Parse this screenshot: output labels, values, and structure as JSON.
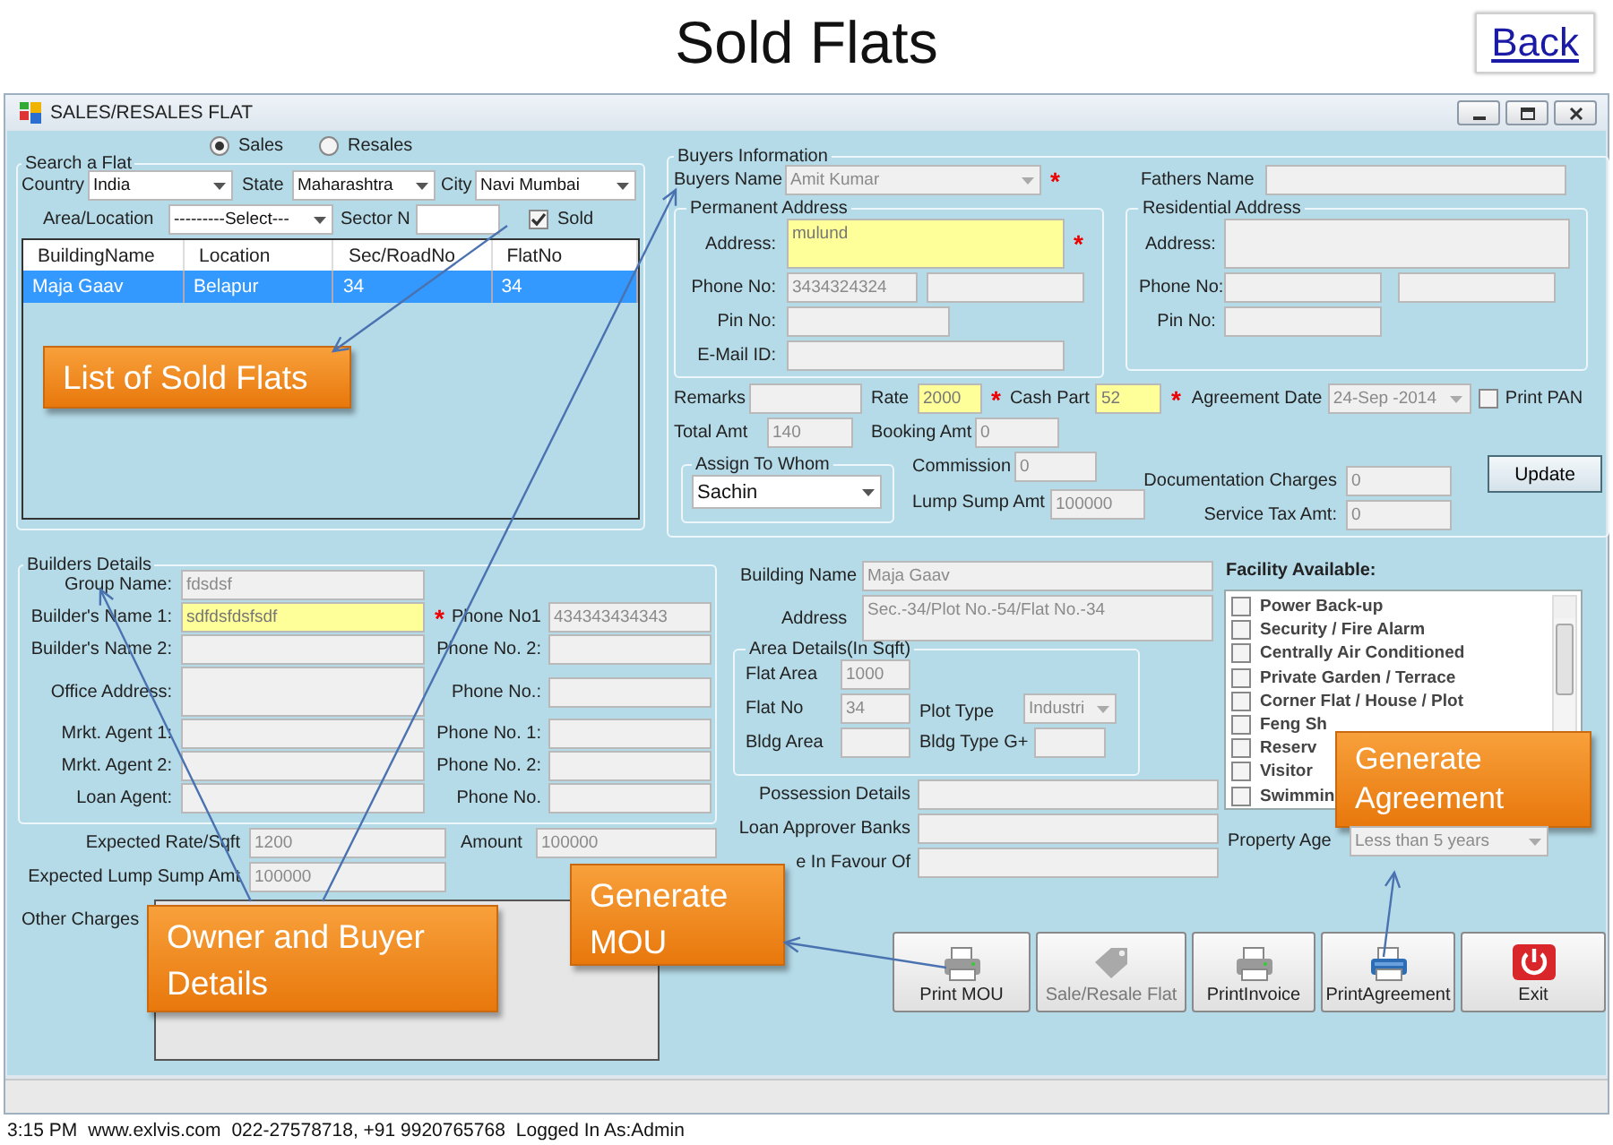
{
  "header": {
    "title": "Sold Flats",
    "back_link": "Back"
  },
  "window": {
    "title": "SALES/RESALES FLAT"
  },
  "sale_type": [
    {
      "label": "Sales",
      "selected": true
    },
    {
      "label": "Resales",
      "selected": false
    }
  ],
  "search_group": {
    "title": "Search a Flat",
    "country": {
      "label": "Country",
      "value": "India",
      "kind": "dropdown",
      "disabled": false
    },
    "state": {
      "label": "State",
      "value": "Maharashtra",
      "kind": "dropdown",
      "disabled": false
    },
    "city": {
      "label": "City",
      "value": "Navi Mumbai",
      "kind": "dropdown",
      "disabled": false
    },
    "area": {
      "label": "Area/Location",
      "value": "---------Select---",
      "kind": "dropdown",
      "disabled": false
    },
    "sector": {
      "label": "Sector N",
      "kind": "text",
      "disabled": false
    },
    "sold": {
      "label": "Sold",
      "checked": true
    },
    "table": {
      "columns": [
        "BuildingName",
        "Location",
        "Sec/RoadNo",
        "FlatNo"
      ],
      "rows": [
        {
          "cells": [
            "Maja Gaav",
            "Belapur",
            "34",
            "34"
          ],
          "selected": true
        }
      ]
    }
  },
  "buyers_group": {
    "title": "Buyers Information",
    "buyers_name": {
      "label": "Buyers Name",
      "value": "Amit Kumar",
      "kind": "dropdown",
      "disabled": true,
      "mark": "*"
    },
    "fathers_name": {
      "label": "Fathers Name",
      "kind": "text",
      "disabled": true
    },
    "permanent_address": {
      "title": "Permanent Address",
      "address": {
        "label": "Address:",
        "value": "mulund",
        "kind": "text",
        "disabled": false,
        "required": true,
        "mark": "*"
      },
      "phone": {
        "label": "Phone No:",
        "value": "3434324324",
        "kind": "text",
        "disabled": true
      },
      "phone_2": {
        "kind": "text",
        "disabled": true
      },
      "pin": {
        "label": "Pin No:",
        "kind": "text",
        "disabled": true
      },
      "email": {
        "label": "E-Mail ID:",
        "kind": "text",
        "disabled": true
      }
    },
    "residential_address": {
      "title": "Residential Address",
      "address": {
        "label": "Address:",
        "kind": "text",
        "disabled": true
      },
      "phone": {
        "label": "Phone No:",
        "kind": "text",
        "disabled": true
      },
      "phone_2": {
        "kind": "text",
        "disabled": true
      },
      "pin": {
        "label": "Pin No:",
        "kind": "text",
        "disabled": true
      }
    },
    "remarks": {
      "label": "Remarks",
      "kind": "text",
      "disabled": true
    },
    "rate": {
      "label": "Rate",
      "value": "2000",
      "kind": "text",
      "disabled": false,
      "required": true,
      "mark": "*"
    },
    "cash_part": {
      "label": "Cash Part",
      "value": "52",
      "kind": "text",
      "disabled": false,
      "required": true,
      "mark": "*"
    },
    "agreement_date": {
      "label": "Agreement Date",
      "value": "24-Sep -2014",
      "kind": "dropdown",
      "disabled": true
    },
    "print_pan": {
      "label": "Print PAN",
      "checked": false
    },
    "total_amt": {
      "label": "Total Amt",
      "value": "140",
      "kind": "text",
      "disabled": true
    },
    "booking_amt": {
      "label": "Booking Amt",
      "value": "0",
      "kind": "text",
      "disabled": true
    },
    "assign_group": {
      "title": "Assign  To Whom",
      "assignee": {
        "value": "Sachin",
        "kind": "dropdown",
        "disabled": false
      }
    },
    "commission": {
      "label": "Commission",
      "value": "0",
      "kind": "text",
      "disabled": true
    },
    "lump_sump_amt": {
      "label": "Lump Sump Amt",
      "value": "100000",
      "kind": "text",
      "disabled": true
    },
    "documentation_charges": {
      "label": "Documentation Charges",
      "value": "0",
      "kind": "text",
      "disabled": true
    },
    "service_tax_amt": {
      "label": "Service Tax Amt:",
      "value": "0",
      "kind": "text",
      "disabled": true
    },
    "update_button": "Update"
  },
  "builders_group": {
    "title": "Builders Details",
    "group_name": {
      "label": "Group Name:",
      "value": "fdsdsf",
      "kind": "text",
      "disabled": true
    },
    "builder_name_1": {
      "label": "Builder's Name 1:",
      "value": "sdfdsfdsfsdf",
      "kind": "text",
      "disabled": false,
      "required": true
    },
    "phone_no1": {
      "label": "Phone No1",
      "value": "434343434343",
      "kind": "text",
      "disabled": true,
      "mark": "*"
    },
    "builder_name_2": {
      "label": "Builder's Name 2:",
      "kind": "text",
      "disabled": true
    },
    "phone_no_2": {
      "label": "Phone No. 2:",
      "kind": "text",
      "disabled": true
    },
    "office_address": {
      "label": "Office Address:",
      "kind": "text",
      "disabled": true
    },
    "office_phone": {
      "label": "Phone No.:",
      "kind": "text",
      "disabled": true
    },
    "agent_1": {
      "label": "Mrkt. Agent 1:",
      "kind": "text",
      "disabled": true
    },
    "agent_1_phone": {
      "label": "Phone No. 1:",
      "kind": "text",
      "disabled": true
    },
    "agent_2": {
      "label": "Mrkt. Agent 2:",
      "kind": "text",
      "disabled": true
    },
    "agent_2_phone": {
      "label": "Phone No. 2:",
      "kind": "text",
      "disabled": true
    },
    "loan_agent": {
      "label": "Loan Agent:",
      "kind": "text",
      "disabled": true
    },
    "loan_agent_phone": {
      "label": "Phone No.",
      "kind": "text",
      "disabled": true
    }
  },
  "expected_rate": {
    "label": "Expected Rate/Sqft",
    "value": "1200",
    "kind": "text",
    "disabled": true
  },
  "amount": {
    "label": "Amount",
    "value": "100000",
    "kind": "text",
    "disabled": true
  },
  "expected_lump_sump": {
    "label": "Expected Lump Sump Amt",
    "value": "100000",
    "kind": "text",
    "disabled": true
  },
  "other_charges": {
    "label": "Other Charges",
    "kind": "text",
    "disabled": true
  },
  "building": {
    "building_name": {
      "label": "Building Name",
      "value": "Maja Gaav",
      "kind": "text",
      "disabled": true
    },
    "address": {
      "label": "Address",
      "value": "Sec.-34/Plot No.-54/Flat No.-34",
      "kind": "text",
      "disabled": true
    },
    "area_group": {
      "title": "Area Details(In Sqft)",
      "flat_area": {
        "label": "Flat Area",
        "value": "1000",
        "kind": "text",
        "disabled": true
      },
      "flat_no": {
        "label": "Flat No",
        "value": "34",
        "kind": "text",
        "disabled": true
      },
      "plot_type": {
        "label": "Plot Type",
        "value": "Industri",
        "kind": "dropdown",
        "disabled": true
      },
      "bldg_area": {
        "label": "Bldg Area",
        "kind": "text",
        "disabled": true
      },
      "bldg_type": {
        "label": "Bldg Type G+",
        "kind": "text",
        "disabled": true
      }
    },
    "possession_details": {
      "label": "Possession Details",
      "kind": "text",
      "disabled": true
    },
    "loan_approver_banks": {
      "label": "Loan Approver Banks",
      "kind": "text",
      "disabled": true
    },
    "sale_in_favour": {
      "label": "e In Favour Of",
      "kind": "text",
      "disabled": true
    }
  },
  "facility": {
    "title": "Facility Available:",
    "items": [
      {
        "label": "Power Back-up",
        "checked": false
      },
      {
        "label": "Security / Fire Alarm",
        "checked": false
      },
      {
        "label": "Centrally Air Conditioned",
        "checked": false
      },
      {
        "label": "Private Garden / Terrace",
        "checked": false
      },
      {
        "label": "Corner Flat / House / Plot",
        "checked": false
      },
      {
        "label": "Feng Sh",
        "checked": false
      },
      {
        "label": "Reserv",
        "checked": false
      },
      {
        "label": "Visitor",
        "checked": false
      },
      {
        "label": "Swimmin",
        "checked": false
      }
    ]
  },
  "property_age": {
    "label": "Property Age",
    "value": "Less than 5 years",
    "kind": "dropdown",
    "disabled": true
  },
  "buttons": [
    {
      "label": "Print MOU",
      "kind": "printer",
      "disabled": false
    },
    {
      "label": "Sale/Resale Flat",
      "kind": "tag",
      "disabled": true
    },
    {
      "label": "PrintInvoice",
      "kind": "printer",
      "disabled": false
    },
    {
      "label": "PrintAgreement",
      "kind": "blue-printer",
      "disabled": false
    },
    {
      "label": "Exit",
      "kind": "power",
      "disabled": false
    }
  ],
  "callouts": [
    {
      "text": "List of Sold Flats"
    },
    {
      "text": "Owner and Buyer Details"
    },
    {
      "text": "Generate MOU"
    },
    {
      "text": "Generate Agreement"
    }
  ],
  "status_bar": [
    "3:15 PM",
    "www.exlvis.com",
    "022-27578718, +91 9920765768",
    "Logged In As:Admin"
  ]
}
